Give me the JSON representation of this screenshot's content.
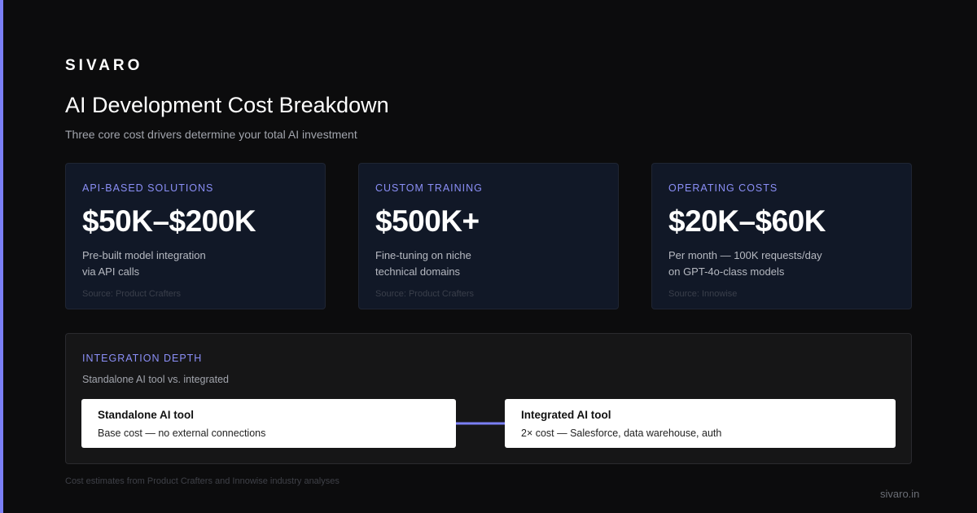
{
  "brand": "SIVARO",
  "title": "AI Development Cost Breakdown",
  "subtitle": "Three core cost drivers determine your total AI investment",
  "cards": [
    {
      "label": "API-BASED SOLUTIONS",
      "value": "$50K–$200K",
      "desc_line1": "Pre-built model integration",
      "desc_line2": "via API calls",
      "source": "Source: Product Crafters"
    },
    {
      "label": "CUSTOM TRAINING",
      "value": "$500K+",
      "desc_line1": "Fine-tuning on niche",
      "desc_line2": "technical domains",
      "source": "Source: Product Crafters"
    },
    {
      "label": "OPERATING COSTS",
      "value": "$20K–$60K",
      "desc_line1": "Per month — 100K requests/day",
      "desc_line2": "on GPT-4o-class models",
      "source": "Source: Innowise"
    }
  ],
  "integration": {
    "label": "INTEGRATION DEPTH",
    "subtitle": "Standalone AI tool vs. integrated",
    "standalone": {
      "name": "Standalone AI tool",
      "desc": "Base cost — no external connections"
    },
    "integrated": {
      "name": "Integrated AI tool",
      "desc": "2× cost — Salesforce, data warehouse, auth"
    }
  },
  "footnote": "Cost estimates from Product Crafters and Innowise industry analyses",
  "site": "sivaro.in",
  "colors": {
    "accent": "#7b7ff5",
    "background": "#0c0c0d",
    "card_background": "#111827",
    "label": "#8b8ff7"
  }
}
